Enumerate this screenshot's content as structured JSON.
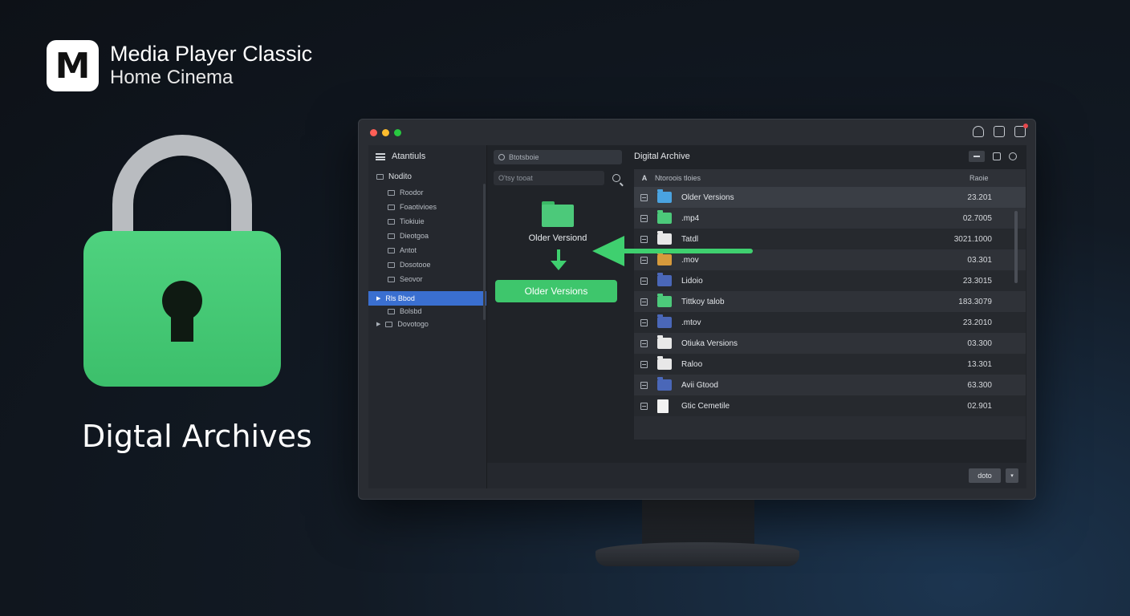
{
  "brand": {
    "logo_letter": "M",
    "line1": "Media Player Classic",
    "line2": "Home Cinema"
  },
  "hero": {
    "title": "Digtal Archives",
    "lock_color": "#4fd27f"
  },
  "window": {
    "traffic_lights": [
      "#ff5f57",
      "#febc2e",
      "#28c840"
    ],
    "titlebar_icons": [
      "user-icon",
      "square-icon",
      "notification-icon"
    ]
  },
  "sidebar": {
    "header": "Atantiuls",
    "top_item": "Nodito",
    "children": [
      "Roodor",
      "Foaotivioes",
      "Tiokiuie",
      "Dieotgoa",
      "Antot",
      "Dosotooe",
      "Seovor"
    ],
    "selected_item": "Rls Bbod",
    "selected_subitem": "Bolsbd",
    "last_item": "Dovotogo"
  },
  "midpane": {
    "search_placeholder": "Btotsboie",
    "filter_placeholder": "O'tsy tooat",
    "folder_label": "Older Versiond",
    "button_label": "Older Versions",
    "accent": "#3ec66c"
  },
  "rightpane": {
    "title": "Digital Archive",
    "columns": {
      "a": "A",
      "name": "Ntoroois tloies",
      "size": "Raoie"
    },
    "rows": [
      {
        "name": "Older Versions",
        "size": "23.201",
        "icon": "folder-blue-icon"
      },
      {
        "name": ".mp4",
        "size": "02.7005",
        "icon": "folder-green-icon"
      },
      {
        "name": "Tatdl",
        "size": "3021.1000",
        "icon": "folder-white-icon"
      },
      {
        "name": ".mov",
        "size": "03.301",
        "icon": "folder-orange-icon"
      },
      {
        "name": "Lidoio",
        "size": "23.3015",
        "icon": "folder-navy-icon"
      },
      {
        "name": "Tittkoy talob",
        "size": "183.3079",
        "icon": "folder-green-icon"
      },
      {
        "name": ".mtov",
        "size": "23.2010",
        "icon": "folder-navy-icon"
      },
      {
        "name": "Otiuka Versions",
        "size": "03.300",
        "icon": "folder-white-icon"
      },
      {
        "name": "Raloo",
        "size": "13.301",
        "icon": "folder-lines-icon"
      },
      {
        "name": "Avii Gtood",
        "size": "63.300",
        "icon": "folder-navy-icon"
      },
      {
        "name": "Gtic Cemetile",
        "size": "02.901",
        "icon": "document-icon"
      }
    ]
  },
  "footer": {
    "button_label": "doto",
    "caret": "▾"
  }
}
